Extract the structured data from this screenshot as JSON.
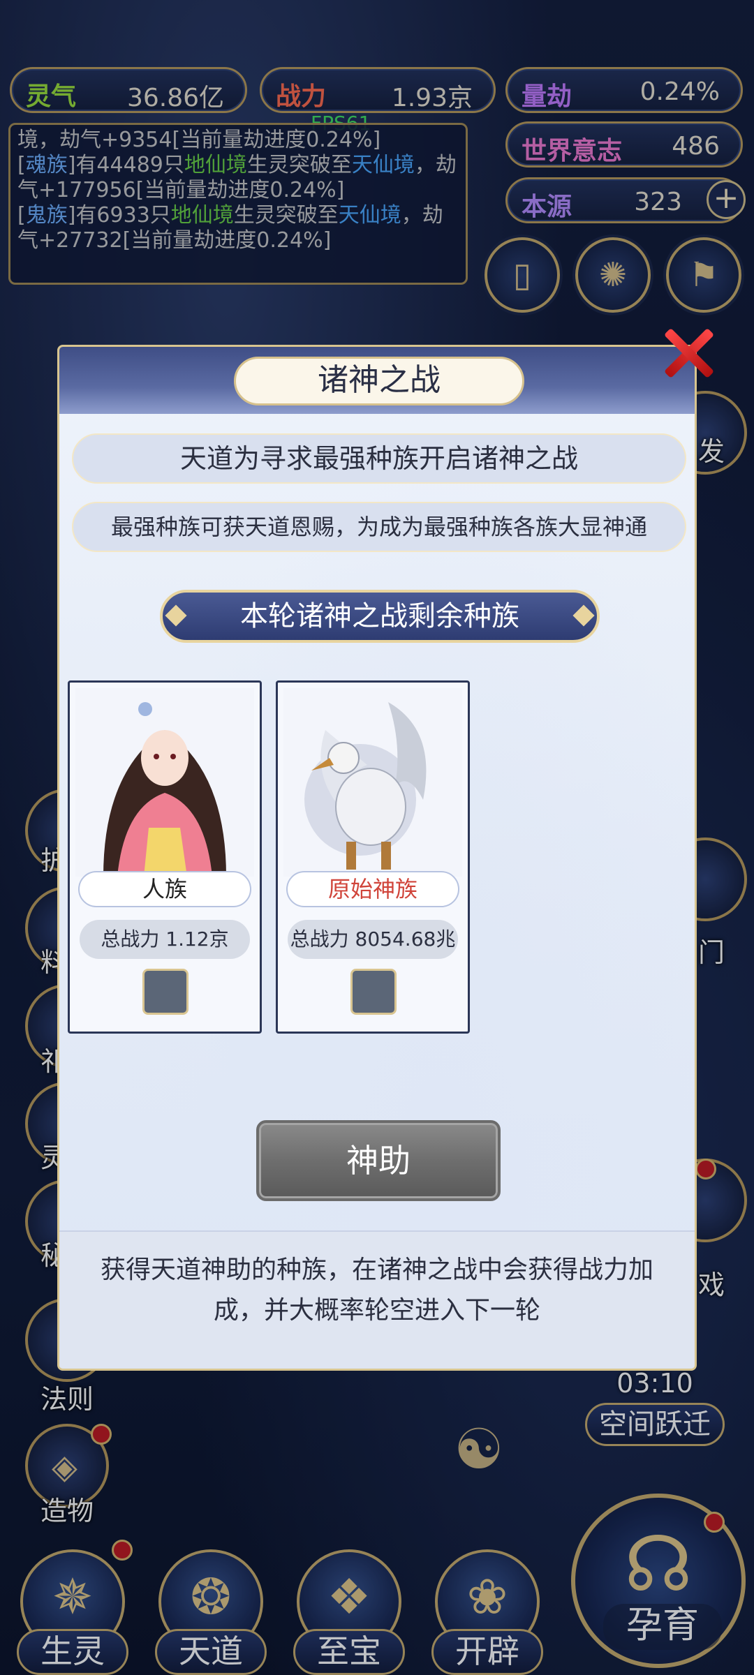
{
  "stats": {
    "lingqi": {
      "label": "灵气",
      "value": "36.86亿"
    },
    "zhanli": {
      "label": "战力",
      "value": "1.93京"
    },
    "liangjie": {
      "label": "量劫",
      "value": "0.24%"
    },
    "shijie": {
      "label": "世界意志",
      "value": "486"
    },
    "benyuan": {
      "label": "本源",
      "value": "323"
    }
  },
  "fps": "FPS61",
  "log": [
    {
      "parts": [
        "境，劫气+9354[当前量劫进度0.24%]"
      ]
    },
    {
      "race": "魂族",
      "count": "有44489只",
      "realm1": "地仙境",
      "mid": "生灵突破至",
      "realm2": "天仙境",
      "tail": "，劫气+177956[当前量劫进度0.24%]"
    },
    {
      "race": "鬼族",
      "count": "有6933只",
      "realm1": "地仙境",
      "mid": "生灵突破至",
      "realm2": "天仙境",
      "tail": "，劫气+27732[当前量劫进度0.24%]"
    }
  ],
  "modal": {
    "title": "诸神之战",
    "subtitle1": "天道为寻求最强种族开启诸神之战",
    "subtitle2": "最强种族可获天道恩赐，为成为最强种族各族大显神通",
    "banner": "本轮诸神之战剩余种族",
    "cards": [
      {
        "name": "人族",
        "power": "总战力 1.12京"
      },
      {
        "name": "原始神族",
        "power": "总战力 8054.68兆"
      }
    ],
    "help_button": "神助",
    "footer": "获得天道神助的种族，在诸神之战中会获得战力加成，并大概率轮空进入下一轮"
  },
  "side": {
    "fa_ze": "法则",
    "zao_wu": "造物",
    "timer": "03:10",
    "kongjian": "空间跃迁",
    "right_partials": [
      "发",
      "门",
      "戏"
    ],
    "left_partials": [
      "护",
      "料",
      "祁",
      "灵",
      "秘"
    ]
  },
  "nav": {
    "shengling": "生灵",
    "tiandao": "天道",
    "zhibao": "至宝",
    "kaipi": "开辟",
    "yunyu": "孕育"
  }
}
